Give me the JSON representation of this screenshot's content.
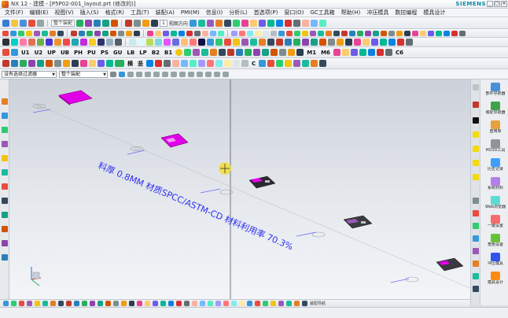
{
  "window": {
    "title": "NX 12 - 建模 - [P5P02-001_layout.prt (修改的)]",
    "brand": "SIEMENS",
    "controls": [
      "_",
      "▢",
      "✕"
    ]
  },
  "menubar": {
    "items": [
      "文件(F)",
      "编辑(E)",
      "视图(V)",
      "插入(S)",
      "格式(R)",
      "工具(T)",
      "装配(A)",
      "PMI(M)",
      "信息(I)",
      "分析(L)",
      "首选项(P)",
      "窗口(O)",
      "GC工具箱",
      "帮助(H)",
      "冲压模具",
      "数控编程",
      "模具设计"
    ]
  },
  "toolbar1": {
    "snap_combo": "整个装配",
    "layer_combo": "1",
    "view_label": "视图方向"
  },
  "toolbar4": {
    "buttons": [
      "U1",
      "U2",
      "UP",
      "UB",
      "PH",
      "PU",
      "PS",
      "GU",
      "LB",
      "LP",
      "B2",
      "B1"
    ],
    "extras": [
      "M1",
      "M6",
      "C6"
    ]
  },
  "toolbar5": {
    "buttons": [
      "横",
      "竖",
      "C"
    ]
  },
  "selection_bar": {
    "filter_value": "没有选择过滤器",
    "scope_value": "整个装配"
  },
  "viewport": {
    "annotation_main": "料厚 0.8MM 材质SPCC/ASTM-CD 材料利用率 70.3%",
    "view_crosshair": "WCS"
  },
  "right_panel": {
    "buttons": [
      {
        "label": "部件导航器",
        "icon": "part-navigator-icon"
      },
      {
        "label": "装配导航器",
        "icon": "assembly-navigator-icon"
      },
      {
        "label": "重用库",
        "icon": "reuse-library-icon"
      },
      {
        "label": "HD3D工具",
        "icon": "hd3d-icon"
      },
      {
        "label": "历史记录",
        "icon": "history-icon"
      },
      {
        "label": "系统材料",
        "icon": "material-icon"
      },
      {
        "label": "Web浏览器",
        "icon": "web-browser-icon"
      },
      {
        "label": "一键设置",
        "icon": "setup-icon"
      },
      {
        "label": "角色设置",
        "icon": "roles-icon"
      },
      {
        "label": "冲压模具",
        "icon": "die-icon"
      },
      {
        "label": "模具设计",
        "icon": "mold-icon"
      }
    ]
  },
  "bottom_toolbar": {
    "label": "装配导航"
  },
  "colors": {
    "accent": "#0b8aa5",
    "annotation": "#2e2ef0",
    "part_magenta": "#d400d8"
  }
}
